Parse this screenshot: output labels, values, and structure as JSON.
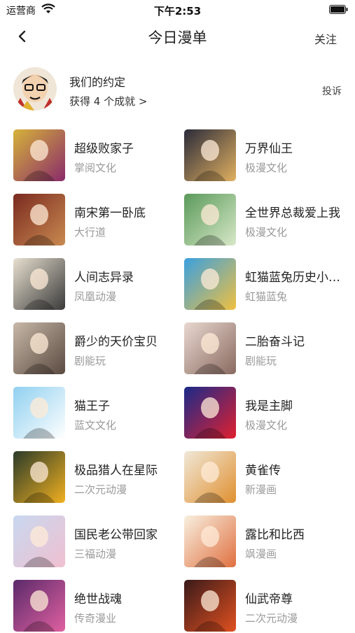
{
  "status_bar": {
    "carrier": "运营商",
    "time": "下午2:53"
  },
  "nav": {
    "title": "今日漫单",
    "follow_label": "关注"
  },
  "author": {
    "name": "我们的约定",
    "achievements": "获得 4 个成就 >",
    "report_label": "投诉"
  },
  "comics": [
    {
      "title": "超级败家子",
      "publisher": "掌阅文化",
      "cover_icon": "cover-image"
    },
    {
      "title": "万界仙王",
      "publisher": "极漫文化",
      "cover_icon": "cover-image"
    },
    {
      "title": "南宋第一卧底",
      "publisher": "大行道",
      "cover_icon": "cover-image"
    },
    {
      "title": "全世界总裁爱上我",
      "publisher": "极漫文化",
      "cover_icon": "cover-image"
    },
    {
      "title": "人间志异录",
      "publisher": "凤凰动漫",
      "cover_icon": "cover-image"
    },
    {
      "title": "虹猫蓝兔历史小剧场",
      "publisher": "虹猫蓝兔",
      "cover_icon": "cover-image"
    },
    {
      "title": "爵少的天价宝贝",
      "publisher": "剧能玩",
      "cover_icon": "cover-image"
    },
    {
      "title": "二胎奋斗记",
      "publisher": "剧能玩",
      "cover_icon": "cover-image"
    },
    {
      "title": "猫王子",
      "publisher": "蓝文文化",
      "cover_icon": "cover-image"
    },
    {
      "title": "我是主脚",
      "publisher": "极漫文化",
      "cover_icon": "cover-image"
    },
    {
      "title": "极品猎人在星际",
      "publisher": "二次元动漫",
      "cover_icon": "cover-image"
    },
    {
      "title": "黄雀传",
      "publisher": "新漫画",
      "cover_icon": "cover-image"
    },
    {
      "title": "国民老公带回家",
      "publisher": "三福动漫",
      "cover_icon": "cover-image"
    },
    {
      "title": "露比和比西",
      "publisher": "飒漫画",
      "cover_icon": "cover-image"
    },
    {
      "title": "绝世战魂",
      "publisher": "传奇漫业",
      "cover_icon": "cover-image"
    },
    {
      "title": "仙武帝尊",
      "publisher": "二次元动漫",
      "cover_icon": "cover-image"
    }
  ],
  "colors": {
    "accent": "#222222",
    "publisher_text": "#9a9a9a",
    "covers": [
      [
        "#d6b33a",
        "#8a2a6a"
      ],
      [
        "#2b2b3a",
        "#e0b060"
      ],
      [
        "#7a2a20",
        "#c98a50"
      ],
      [
        "#5a9a5a",
        "#d8e8c8"
      ],
      [
        "#e8e0d0",
        "#3a3a3a"
      ],
      [
        "#3aa0e0",
        "#f0c040"
      ],
      [
        "#c8b8a8",
        "#5a4a40"
      ],
      [
        "#e8d8d0",
        "#8a6a60"
      ],
      [
        "#90d0f0",
        "#ffffff"
      ],
      [
        "#1a2a8a",
        "#e02030"
      ],
      [
        "#2a3a2a",
        "#f0b020"
      ],
      [
        "#f0e8d8",
        "#e09030"
      ],
      [
        "#c8d8f0",
        "#f0c0d0"
      ],
      [
        "#f8f0e0",
        "#e07040"
      ],
      [
        "#5a2a6a",
        "#e060a0"
      ],
      [
        "#3a1a1a",
        "#e05020"
      ]
    ]
  }
}
